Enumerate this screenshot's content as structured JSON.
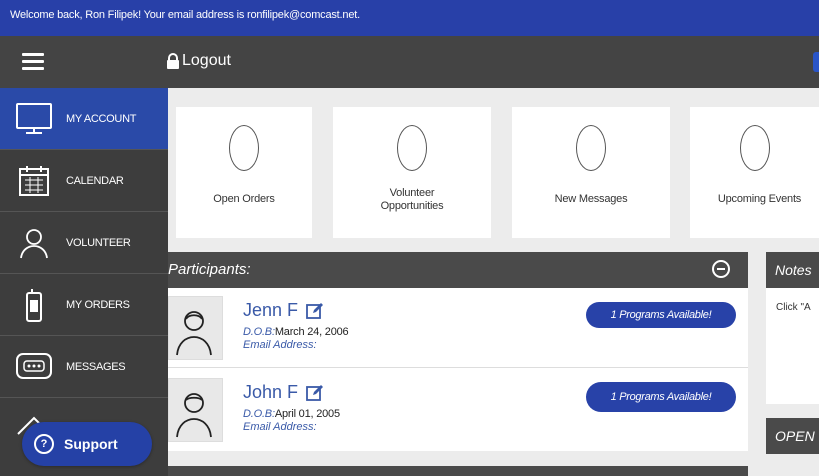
{
  "welcome": {
    "text": "Welcome back, Ron Filipek! Your email address is ronfilipek@comcast.net."
  },
  "topbar": {
    "logout_label": "Logout",
    "menu_icon": "hamburger-icon",
    "lock_icon": "lock-icon"
  },
  "sidebar": {
    "items": [
      {
        "label": "MY ACCOUNT",
        "icon": "monitor-icon",
        "active": true
      },
      {
        "label": "CALENDAR",
        "icon": "calendar-icon",
        "active": false
      },
      {
        "label": "VOLUNTEER",
        "icon": "person-icon",
        "active": false
      },
      {
        "label": "MY ORDERS",
        "icon": "phone-icon",
        "active": false
      },
      {
        "label": "MESSAGES",
        "icon": "message-icon",
        "active": false
      },
      {
        "label": "",
        "icon": "home-icon",
        "active": false
      }
    ]
  },
  "support": {
    "label": "Support",
    "icon": "question-icon"
  },
  "cards": [
    {
      "value": "0",
      "label": "Open Orders"
    },
    {
      "value": "0",
      "label": "Volunteer Opportunities"
    },
    {
      "value": "0",
      "label": "New Messages"
    },
    {
      "value": "0",
      "label": "Upcoming Events"
    }
  ],
  "participants": {
    "header": "Participants:",
    "list": [
      {
        "name": "Jenn F",
        "dob_label": "D.O.B:",
        "dob": "March 24, 2006",
        "email_label": "Email Address:",
        "programs_label": "1 Programs Available!"
      },
      {
        "name": "John F",
        "dob_label": "D.O.B:",
        "dob": "April 01, 2005",
        "email_label": "Email Address:",
        "programs_label": "1 Programs Available!"
      }
    ]
  },
  "notes": {
    "header": "Notes",
    "body": "Click \"A"
  },
  "open": {
    "header": "OPEN"
  },
  "colors": {
    "primary": "#2a4aa8",
    "dark": "#444444",
    "background": "#ececec"
  }
}
